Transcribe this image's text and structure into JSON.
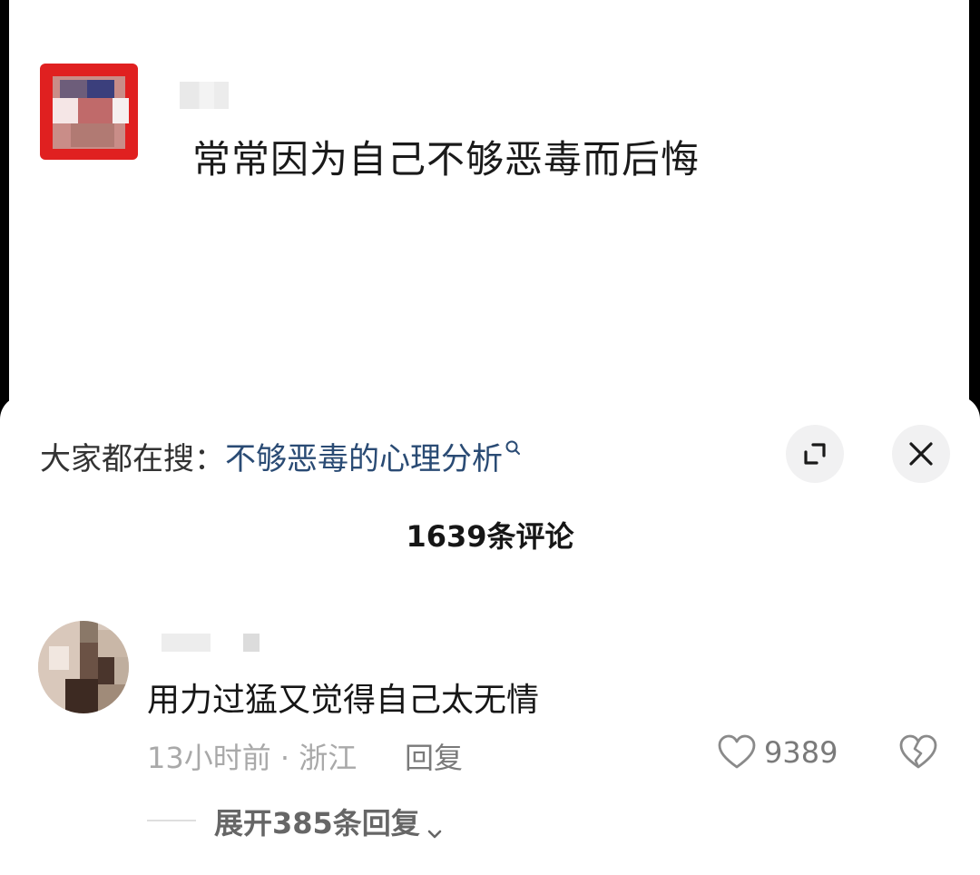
{
  "post": {
    "text": "常常因为自己不够恶毒而后悔"
  },
  "search_bar": {
    "prefix": "大家都在搜：",
    "query": "不够恶毒的心理分析"
  },
  "comments_header": {
    "count_label": "1639条评论"
  },
  "comment": {
    "text": "用力过猛又觉得自己太无情",
    "meta": "13小时前 · 浙江",
    "reply_label": "回复",
    "likes": "9389",
    "expand_label": "展开385条回复"
  },
  "icons": {
    "expand": "expand-icon",
    "close": "close-icon",
    "search": "search-icon",
    "like": "heart-icon",
    "dislike": "broken-heart-icon",
    "chevron": "chevron-down-icon"
  }
}
